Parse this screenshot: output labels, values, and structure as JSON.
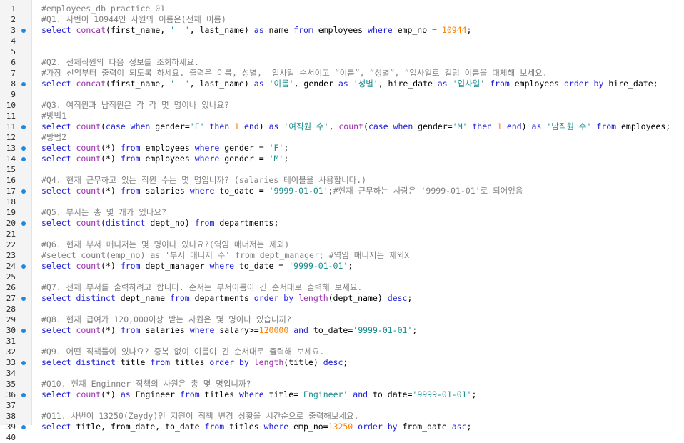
{
  "editor": {
    "colors": {
      "keyword": "#1c1cd6",
      "function": "#9b2fae",
      "string": "#1a8c8c",
      "number": "#ff8000",
      "comment": "#808080",
      "marker": "#1e88e5"
    },
    "lines": [
      {
        "n": "1",
        "marker": false,
        "tokens": [
          [
            "c",
            "#employees_db practice 01"
          ]
        ]
      },
      {
        "n": "2",
        "marker": false,
        "tokens": [
          [
            "c",
            "#Q1. 사번이 10944인 사원의 이름은(전체 이름)"
          ]
        ]
      },
      {
        "n": "3",
        "marker": true,
        "tokens": [
          [
            "k",
            "select"
          ],
          [
            "t",
            " "
          ],
          [
            "f",
            "concat"
          ],
          [
            "t",
            "(first_name, "
          ],
          [
            "s",
            "'  '"
          ],
          [
            "t",
            ", last_name) "
          ],
          [
            "k",
            "as"
          ],
          [
            "t",
            " name "
          ],
          [
            "k",
            "from"
          ],
          [
            "t",
            " employees "
          ],
          [
            "k",
            "where"
          ],
          [
            "t",
            " emp_no = "
          ],
          [
            "n",
            "10944"
          ],
          [
            "t",
            ";"
          ]
        ]
      },
      {
        "n": "4",
        "marker": false,
        "tokens": []
      },
      {
        "n": "5",
        "marker": false,
        "tokens": []
      },
      {
        "n": "6",
        "marker": false,
        "tokens": [
          [
            "c",
            "#Q2. 전체직원의 다음 정보를 조회하세요."
          ]
        ]
      },
      {
        "n": "7",
        "marker": false,
        "tokens": [
          [
            "c",
            "#가장 선임부터 출력이 되도록 하세요. 출력은 이름, 성별,  입사일 순서이고 “이름”, “성별”, “입사일로 컬럼 이름을 대체해 보세요."
          ]
        ]
      },
      {
        "n": "8",
        "marker": true,
        "tokens": [
          [
            "k",
            "select"
          ],
          [
            "t",
            " "
          ],
          [
            "f",
            "concat"
          ],
          [
            "t",
            "(first_name, "
          ],
          [
            "s",
            "'  '"
          ],
          [
            "t",
            ", last_name) "
          ],
          [
            "k",
            "as"
          ],
          [
            "t",
            " "
          ],
          [
            "s",
            "'이름'"
          ],
          [
            "t",
            ", gender "
          ],
          [
            "k",
            "as"
          ],
          [
            "t",
            " "
          ],
          [
            "s",
            "'성별'"
          ],
          [
            "t",
            ", hire_date "
          ],
          [
            "k",
            "as"
          ],
          [
            "t",
            " "
          ],
          [
            "s",
            "'입사일'"
          ],
          [
            "t",
            " "
          ],
          [
            "k",
            "from"
          ],
          [
            "t",
            " employees "
          ],
          [
            "k",
            "order by"
          ],
          [
            "t",
            " hire_date;"
          ]
        ]
      },
      {
        "n": "9",
        "marker": false,
        "tokens": []
      },
      {
        "n": "10",
        "marker": false,
        "tokens": [
          [
            "c",
            "#Q3. 여직원과 남직원은 각 각 몇 명이나 있나요?"
          ]
        ]
      },
      {
        "n": "11",
        "marker": false,
        "tokens": [
          [
            "c",
            "#방법1"
          ]
        ]
      },
      {
        "n": "11",
        "marker": true,
        "tokens": [
          [
            "k",
            "select"
          ],
          [
            "t",
            " "
          ],
          [
            "f",
            "count"
          ],
          [
            "t",
            "("
          ],
          [
            "k",
            "case when"
          ],
          [
            "t",
            " gender="
          ],
          [
            "s",
            "'F'"
          ],
          [
            "t",
            " "
          ],
          [
            "k",
            "then"
          ],
          [
            "t",
            " "
          ],
          [
            "n",
            "1"
          ],
          [
            "t",
            " "
          ],
          [
            "k",
            "end"
          ],
          [
            "t",
            ") "
          ],
          [
            "k",
            "as"
          ],
          [
            "t",
            " "
          ],
          [
            "s",
            "'여직원 수'"
          ],
          [
            "t",
            ", "
          ],
          [
            "f",
            "count"
          ],
          [
            "t",
            "("
          ],
          [
            "k",
            "case when"
          ],
          [
            "t",
            " gender="
          ],
          [
            "s",
            "'M'"
          ],
          [
            "t",
            " "
          ],
          [
            "k",
            "then"
          ],
          [
            "t",
            " "
          ],
          [
            "n",
            "1"
          ],
          [
            "t",
            " "
          ],
          [
            "k",
            "end"
          ],
          [
            "t",
            ") "
          ],
          [
            "k",
            "as"
          ],
          [
            "t",
            " "
          ],
          [
            "s",
            "'남직원 수'"
          ],
          [
            "t",
            " "
          ],
          [
            "k",
            "from"
          ],
          [
            "t",
            " employees;"
          ]
        ]
      },
      {
        "n": "12",
        "marker": false,
        "tokens": [
          [
            "c",
            "#방법2"
          ]
        ]
      },
      {
        "n": "13",
        "marker": true,
        "tokens": [
          [
            "k",
            "select"
          ],
          [
            "t",
            " "
          ],
          [
            "f",
            "count"
          ],
          [
            "t",
            "(*) "
          ],
          [
            "k",
            "from"
          ],
          [
            "t",
            " employees "
          ],
          [
            "k",
            "where"
          ],
          [
            "t",
            " gender = "
          ],
          [
            "s",
            "'F'"
          ],
          [
            "t",
            ";"
          ]
        ]
      },
      {
        "n": "14",
        "marker": true,
        "tokens": [
          [
            "k",
            "select"
          ],
          [
            "t",
            " "
          ],
          [
            "f",
            "count"
          ],
          [
            "t",
            "(*) "
          ],
          [
            "k",
            "from"
          ],
          [
            "t",
            " employees "
          ],
          [
            "k",
            "where"
          ],
          [
            "t",
            " gender = "
          ],
          [
            "s",
            "'M'"
          ],
          [
            "t",
            ";"
          ]
        ]
      },
      {
        "n": "15",
        "marker": false,
        "tokens": []
      },
      {
        "n": "16",
        "marker": false,
        "tokens": [
          [
            "c",
            "#Q4. 현재 근무하고 있는 직원 수는 몇 명입니까? (salaries 테이블을 사용합니다.)"
          ]
        ]
      },
      {
        "n": "17",
        "marker": true,
        "tokens": [
          [
            "k",
            "select"
          ],
          [
            "t",
            " "
          ],
          [
            "f",
            "count"
          ],
          [
            "t",
            "(*) "
          ],
          [
            "k",
            "from"
          ],
          [
            "t",
            " salaries "
          ],
          [
            "k",
            "where"
          ],
          [
            "t",
            " to_date = "
          ],
          [
            "s",
            "'9999-01-01'"
          ],
          [
            "t",
            ";"
          ],
          [
            "c",
            "#현재 근무하는 사람은 '9999-01-01'로 되어있음"
          ]
        ]
      },
      {
        "n": "18",
        "marker": false,
        "tokens": []
      },
      {
        "n": "19",
        "marker": false,
        "tokens": [
          [
            "c",
            "#Q5. 부서는 총 몇 개가 있나요?"
          ]
        ]
      },
      {
        "n": "20",
        "marker": true,
        "tokens": [
          [
            "k",
            "select"
          ],
          [
            "t",
            " "
          ],
          [
            "f",
            "count"
          ],
          [
            "t",
            "("
          ],
          [
            "k",
            "distinct"
          ],
          [
            "t",
            " dept_no) "
          ],
          [
            "k",
            "from"
          ],
          [
            "t",
            " departments;"
          ]
        ]
      },
      {
        "n": "21",
        "marker": false,
        "tokens": []
      },
      {
        "n": "22",
        "marker": false,
        "tokens": [
          [
            "c",
            "#Q6. 현재 부서 매니저는 몇 명이나 있나요?(역임 매너저는 제외)"
          ]
        ]
      },
      {
        "n": "23",
        "marker": false,
        "tokens": [
          [
            "c",
            "#select count(emp_no) as '부서 매니저 수' from dept_manager; #역임 매니저는 제외X"
          ]
        ]
      },
      {
        "n": "24",
        "marker": true,
        "tokens": [
          [
            "k",
            "select"
          ],
          [
            "t",
            " "
          ],
          [
            "f",
            "count"
          ],
          [
            "t",
            "(*) "
          ],
          [
            "k",
            "from"
          ],
          [
            "t",
            " dept_manager "
          ],
          [
            "k",
            "where"
          ],
          [
            "t",
            " to_date = "
          ],
          [
            "s",
            "'9999-01-01'"
          ],
          [
            "t",
            ";"
          ]
        ]
      },
      {
        "n": "25",
        "marker": false,
        "tokens": []
      },
      {
        "n": "26",
        "marker": false,
        "tokens": [
          [
            "c",
            "#Q7. 전체 부서를 출력하려고 합니다. 순서는 부서이름이 긴 순서대로 출력해 보세요."
          ]
        ]
      },
      {
        "n": "27",
        "marker": true,
        "tokens": [
          [
            "k",
            "select distinct"
          ],
          [
            "t",
            " dept_name "
          ],
          [
            "k",
            "from"
          ],
          [
            "t",
            " departments "
          ],
          [
            "k",
            "order by"
          ],
          [
            "t",
            " "
          ],
          [
            "f",
            "length"
          ],
          [
            "t",
            "(dept_name) "
          ],
          [
            "k",
            "desc"
          ],
          [
            "t",
            ";"
          ]
        ]
      },
      {
        "n": "28",
        "marker": false,
        "tokens": []
      },
      {
        "n": "29",
        "marker": false,
        "tokens": [
          [
            "c",
            "#Q8. 현재 급여가 120,000이상 받는 사원은 몇 명이나 있습니까?"
          ]
        ]
      },
      {
        "n": "30",
        "marker": true,
        "tokens": [
          [
            "k",
            "select"
          ],
          [
            "t",
            " "
          ],
          [
            "f",
            "count"
          ],
          [
            "t",
            "(*) "
          ],
          [
            "k",
            "from"
          ],
          [
            "t",
            " salaries "
          ],
          [
            "k",
            "where"
          ],
          [
            "t",
            " salary>="
          ],
          [
            "n",
            "120000"
          ],
          [
            "t",
            " "
          ],
          [
            "k",
            "and"
          ],
          [
            "t",
            " to_date="
          ],
          [
            "s",
            "'9999-01-01'"
          ],
          [
            "t",
            ";"
          ]
        ]
      },
      {
        "n": "31",
        "marker": false,
        "tokens": []
      },
      {
        "n": "32",
        "marker": false,
        "tokens": [
          [
            "c",
            "#Q9. 어떤 직책들이 있나요? 중복 없이 이름이 긴 순서대로 출력해 보세요."
          ]
        ]
      },
      {
        "n": "33",
        "marker": true,
        "tokens": [
          [
            "k",
            "select distinct"
          ],
          [
            "t",
            " title "
          ],
          [
            "k",
            "from"
          ],
          [
            "t",
            " titles "
          ],
          [
            "k",
            "order by"
          ],
          [
            "t",
            " "
          ],
          [
            "f",
            "length"
          ],
          [
            "t",
            "(title) "
          ],
          [
            "k",
            "desc"
          ],
          [
            "t",
            ";"
          ]
        ]
      },
      {
        "n": "34",
        "marker": false,
        "tokens": []
      },
      {
        "n": "35",
        "marker": false,
        "tokens": [
          [
            "c",
            "#Q10. 현재 Enginner 직책의 사원은 총 몇 명입니까?"
          ]
        ]
      },
      {
        "n": "36",
        "marker": true,
        "tokens": [
          [
            "k",
            "select"
          ],
          [
            "t",
            " "
          ],
          [
            "f",
            "count"
          ],
          [
            "t",
            "(*) "
          ],
          [
            "k",
            "as"
          ],
          [
            "t",
            " Engineer "
          ],
          [
            "k",
            "from"
          ],
          [
            "t",
            " titles "
          ],
          [
            "k",
            "where"
          ],
          [
            "t",
            " title="
          ],
          [
            "s",
            "'Engineer'"
          ],
          [
            "t",
            " "
          ],
          [
            "k",
            "and"
          ],
          [
            "t",
            " to_date="
          ],
          [
            "s",
            "'9999-01-01'"
          ],
          [
            "t",
            ";"
          ]
        ]
      },
      {
        "n": "37",
        "marker": false,
        "tokens": []
      },
      {
        "n": "38",
        "marker": false,
        "tokens": [
          [
            "c",
            "#Q11. 사번이 13250(Zeydy)인 지원이 직책 변경 상황을 시간순으로 출력해보세요."
          ]
        ]
      },
      {
        "n": "39",
        "marker": true,
        "tokens": [
          [
            "k",
            "select"
          ],
          [
            "t",
            " title, from_date, to_date "
          ],
          [
            "k",
            "from"
          ],
          [
            "t",
            " titles "
          ],
          [
            "k",
            "where"
          ],
          [
            "t",
            " emp_no="
          ],
          [
            "n",
            "13250"
          ],
          [
            "t",
            " "
          ],
          [
            "k",
            "order by"
          ],
          [
            "t",
            " from_date "
          ],
          [
            "k",
            "asc"
          ],
          [
            "t",
            ";"
          ]
        ]
      },
      {
        "n": "40",
        "marker": false,
        "tokens": []
      }
    ]
  }
}
